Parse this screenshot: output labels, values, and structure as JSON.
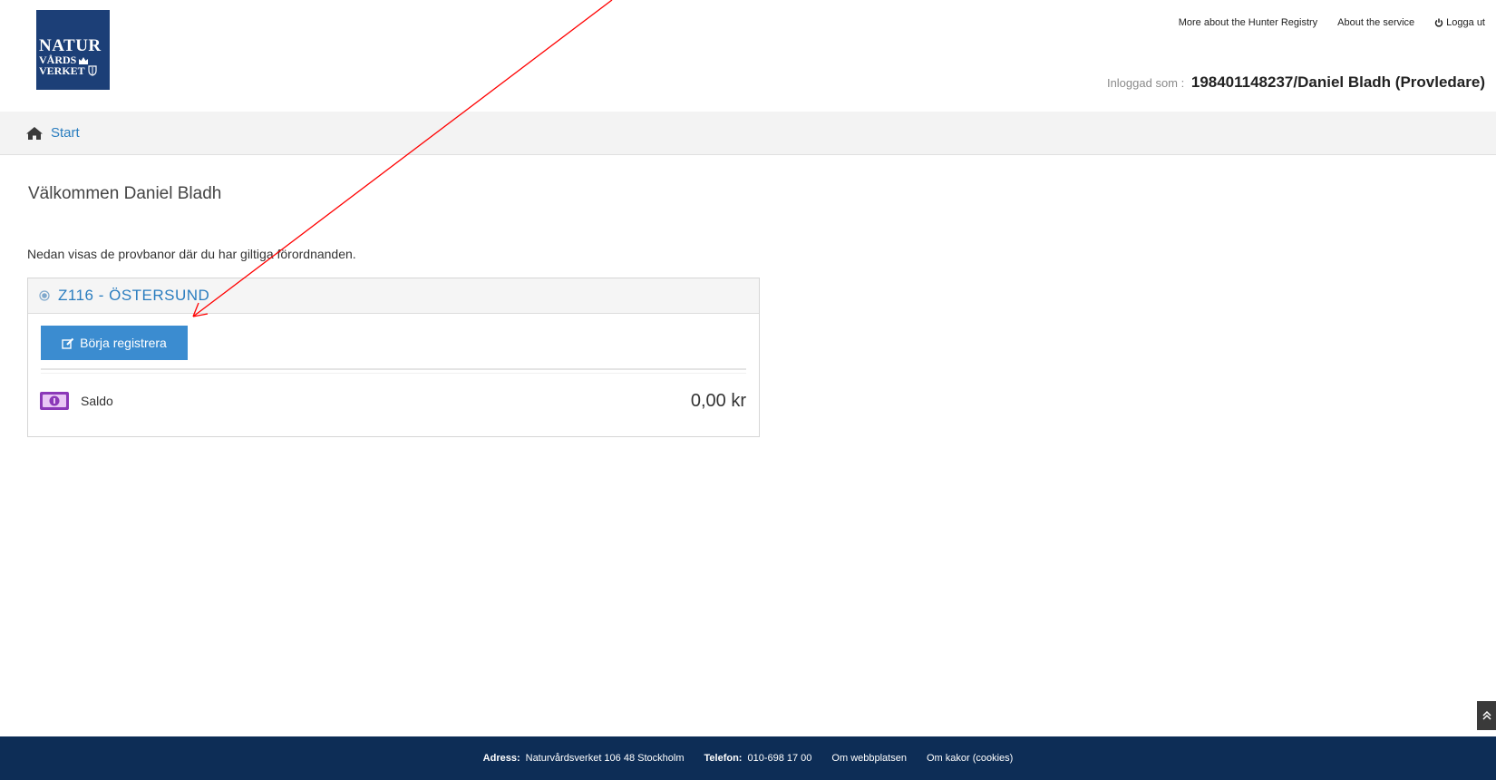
{
  "logo": {
    "line1": "NATUR",
    "line2": "VÅRDS",
    "line3": "VERKET"
  },
  "topnav": {
    "more_about": "More about the Hunter Registry",
    "about_service": "About the service",
    "logout": "Logga ut"
  },
  "user": {
    "prefix": "Inloggad som :",
    "name": "198401148237/Daniel Bladh (Provledare)"
  },
  "breadcrumb": {
    "start": "Start"
  },
  "welcome": "Välkommen Daniel Bladh",
  "intro": "Nedan visas de provbanor där du har giltiga förordnanden.",
  "range": {
    "title": "Z116 - ÖSTERSUND",
    "button": "Börja registrera",
    "saldo_label": "Saldo",
    "saldo_value": "0,00 kr"
  },
  "footer": {
    "address_label": "Adress:",
    "address": "Naturvårdsverket 106 48 Stockholm",
    "phone_label": "Telefon:",
    "phone": "010-698 17 00",
    "link1": "Om webbplatsen",
    "link2": "Om kakor (cookies)"
  },
  "colors": {
    "brand": "#1c3f77",
    "accent": "#3b8cd0",
    "footer": "#0d2d56",
    "annotation": "#ff0000",
    "saldo_icon": "#8b38b8"
  }
}
